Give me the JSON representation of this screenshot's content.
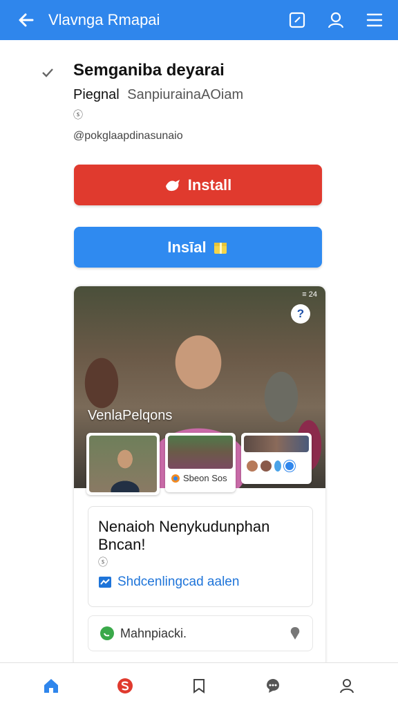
{
  "appbar": {
    "title": "Vlavnga Rmapai",
    "icons": [
      "arrow-left-icon",
      "edit-square-icon",
      "person-icon",
      "menu-icon"
    ],
    "color": "#2f86ec"
  },
  "app_info": {
    "name": "Semganiba deyarai",
    "publisher_main": "Piegnal",
    "publisher_sub": "SanpiurainaAOiam",
    "meta": "ⓢ",
    "handle": "@pokglaapdinasunaio"
  },
  "buttons": {
    "install_primary": "Install",
    "install_secondary": "Insīal",
    "primary_color": "#e03a2e",
    "secondary_color": "#2f8af0"
  },
  "card": {
    "status": "≡ 24",
    "help": "?",
    "photo_label": "VenlaPelqons",
    "thumb2_caption": "Sbeon Sos",
    "info_title": "Nenaioh Nenykudunphan Bncan!",
    "info_meta": "ⓢ",
    "info_link": "Shdcenlingcad aalen",
    "mini_row_text": "Mahnpiacki."
  },
  "bottom_nav": {
    "items": [
      "home-icon",
      "s-badge-icon",
      "bookmark-icon",
      "chat-icon",
      "profile-icon"
    ],
    "active": "home-icon"
  }
}
